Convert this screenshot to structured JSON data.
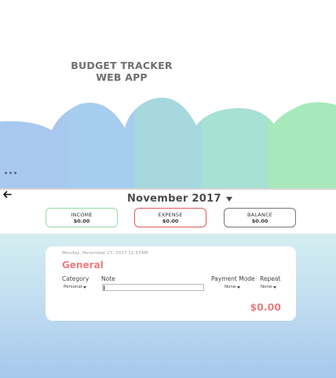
{
  "colors": {
    "stripes": [
      "#a8c8ef",
      "#a6cdee",
      "#a6d8de",
      "#a7e0d4",
      "#a7e9bb"
    ],
    "income_border": "#97d9aa",
    "expense_border": "#e05a5a",
    "balance_border": "#757575",
    "accent_red": "#ee7c7c"
  },
  "hero": {
    "title_line1": "BUDGET TRACKER",
    "title_line2": "WEB APP",
    "menu_icon": "more-horizontal-icon"
  },
  "header": {
    "back_icon": "arrow-left-icon",
    "month": "November 2017",
    "month_icon": "caret-down-icon"
  },
  "summary": {
    "income": {
      "label": "INCOME",
      "value": "$0.00"
    },
    "expense": {
      "label": "EXPENSE",
      "value": "$0.00"
    },
    "balance": {
      "label": "BALANCE",
      "value": "$0.00"
    }
  },
  "entry": {
    "date": "Monday, November 27, 2017 11:57AM",
    "category_title": "General",
    "labels": {
      "category": "Category",
      "note": "Note",
      "payment_mode": "Payment Mode",
      "repeat": "Repeat"
    },
    "category_value": "Personal",
    "note_value": "",
    "payment_mode_value": "None",
    "repeat_value": "None",
    "amount": "$0.00"
  }
}
